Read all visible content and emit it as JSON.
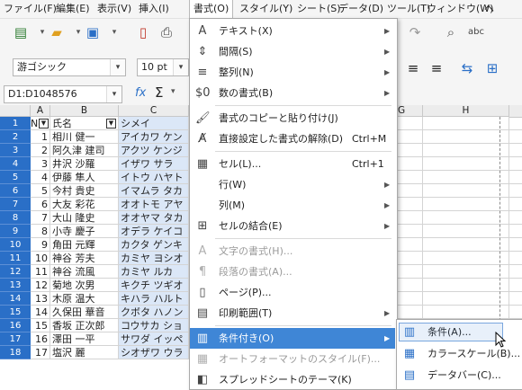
{
  "menubar": {
    "items": [
      {
        "label": "ファイル(F)"
      },
      {
        "label": "編集(E)"
      },
      {
        "label": "表示(V)"
      },
      {
        "label": "挿入(I)"
      },
      {
        "label": "書式(O)"
      },
      {
        "label": "スタイル(Y)"
      },
      {
        "label": "シート(S)"
      },
      {
        "label": "データ(D)"
      },
      {
        "label": "ツール(T)"
      },
      {
        "label": "ウィンドウ(W)"
      },
      {
        "label": "ヘ"
      }
    ],
    "active_index": 4
  },
  "toolbar": {
    "font_name": "游ゴシック",
    "font_size": "10 pt",
    "icons": [
      "new-icon",
      "open-icon",
      "save-icon",
      "export-pdf-icon",
      "print-icon"
    ]
  },
  "formula_bar": {
    "name_box": "D1:D1048576",
    "fx": "fx",
    "sum": "Σ"
  },
  "sheet": {
    "columns": [
      "A",
      "B",
      "C",
      "G",
      "H"
    ],
    "header_row": {
      "a": "No",
      "b": "氏名",
      "c": "シメイ"
    },
    "rows": [
      {
        "row": "2",
        "no": "1",
        "name": "相川 健一",
        "kana": "アイカワ ケン"
      },
      {
        "row": "3",
        "no": "2",
        "name": "阿久津 建司",
        "kana": "アクツ ケンジ"
      },
      {
        "row": "4",
        "no": "3",
        "name": "井沢 沙羅",
        "kana": "イザワ サラ"
      },
      {
        "row": "5",
        "no": "4",
        "name": "伊藤 隼人",
        "kana": "イトウ ハヤト"
      },
      {
        "row": "6",
        "no": "5",
        "name": "今村 貴史",
        "kana": "イマムラ タカ"
      },
      {
        "row": "7",
        "no": "6",
        "name": "大友 彩花",
        "kana": "オオトモ アヤ"
      },
      {
        "row": "8",
        "no": "7",
        "name": "大山 隆史",
        "kana": "オオヤマ タカ"
      },
      {
        "row": "9",
        "no": "8",
        "name": "小寺 慶子",
        "kana": "オデラ ケイコ"
      },
      {
        "row": "10",
        "no": "9",
        "name": "角田 元輝",
        "kana": "カクタ ゲンキ"
      },
      {
        "row": "11",
        "no": "10",
        "name": "神谷 芳夫",
        "kana": "カミヤ ヨシオ"
      },
      {
        "row": "12",
        "no": "11",
        "name": "神谷 流風",
        "kana": "カミヤ ルカ"
      },
      {
        "row": "13",
        "no": "12",
        "name": "菊地 次男",
        "kana": "キクチ ツギオ"
      },
      {
        "row": "14",
        "no": "13",
        "name": "木原 温大",
        "kana": "キハラ ハルト"
      },
      {
        "row": "15",
        "no": "14",
        "name": "久保田 華音",
        "kana": "クボタ ハノン"
      },
      {
        "row": "16",
        "no": "15",
        "name": "香坂 正次郎",
        "kana": "コウサカ ショ"
      },
      {
        "row": "17",
        "no": "16",
        "name": "澤田 一平",
        "kana": "サワダ イッペ"
      },
      {
        "row": "18",
        "no": "17",
        "name": "塩沢 麗",
        "kana": "シオザワ ウラ"
      }
    ]
  },
  "format_menu": {
    "items": [
      {
        "icon": "text-icon",
        "glyph": "A",
        "label": "テキスト(X)",
        "shortcut": "",
        "submenu": true,
        "disabled": false
      },
      {
        "icon": "spacing-icon",
        "glyph": "⇕",
        "label": "間隔(S)",
        "shortcut": "",
        "submenu": true,
        "disabled": false
      },
      {
        "icon": "align-icon",
        "glyph": "≡",
        "label": "整列(N)",
        "shortcut": "",
        "submenu": true,
        "disabled": false
      },
      {
        "icon": "number-format-icon",
        "glyph": "$0",
        "label": "数の書式(B)",
        "shortcut": "",
        "submenu": true,
        "disabled": false
      },
      {
        "sep": true
      },
      {
        "icon": "clone-format-icon",
        "glyph": "🖌",
        "label": "書式のコピーと貼り付け(J)",
        "shortcut": "",
        "submenu": false,
        "disabled": false
      },
      {
        "icon": "clear-format-icon",
        "glyph": "A̸",
        "label": "直接設定した書式の解除(D)",
        "shortcut": "Ctrl+M",
        "submenu": false,
        "disabled": false
      },
      {
        "sep": true
      },
      {
        "icon": "cells-icon",
        "glyph": "▦",
        "label": "セル(L)...",
        "shortcut": "Ctrl+1",
        "submenu": false,
        "disabled": false
      },
      {
        "icon": "",
        "glyph": "",
        "label": "行(W)",
        "shortcut": "",
        "submenu": true,
        "disabled": false
      },
      {
        "icon": "",
        "glyph": "",
        "label": "列(M)",
        "shortcut": "",
        "submenu": true,
        "disabled": false
      },
      {
        "icon": "merge-cells-icon",
        "glyph": "⊞",
        "label": "セルの結合(E)",
        "shortcut": "",
        "submenu": true,
        "disabled": false
      },
      {
        "sep": true
      },
      {
        "icon": "character-icon",
        "glyph": "A",
        "label": "文字の書式(H)...",
        "shortcut": "",
        "submenu": false,
        "disabled": true
      },
      {
        "icon": "paragraph-icon",
        "glyph": "¶",
        "label": "段落の書式(A)...",
        "shortcut": "",
        "submenu": false,
        "disabled": true
      },
      {
        "icon": "page-icon",
        "glyph": "▯",
        "label": "ページ(P)...",
        "shortcut": "",
        "submenu": false,
        "disabled": false
      },
      {
        "icon": "print-range-icon",
        "glyph": "▤",
        "label": "印刷範囲(T)",
        "shortcut": "",
        "submenu": true,
        "disabled": false
      },
      {
        "sep": true
      },
      {
        "icon": "conditional-icon",
        "glyph": "▥",
        "label": "条件付き(O)",
        "shortcut": "",
        "submenu": true,
        "disabled": false,
        "highlight": true
      },
      {
        "icon": "autoformat-icon",
        "glyph": "▦",
        "label": "オートフォーマットのスタイル(F)...",
        "shortcut": "",
        "submenu": false,
        "disabled": true
      },
      {
        "icon": "theme-icon",
        "glyph": "◧",
        "label": "スプレッドシートのテーマ(K)",
        "shortcut": "",
        "submenu": false,
        "disabled": false
      }
    ]
  },
  "conditional_submenu": {
    "items": [
      {
        "icon": "condition-icon",
        "glyph": "▥",
        "label": "条件(A)..."
      },
      {
        "icon": "color-scale-icon",
        "glyph": "▦",
        "label": "カラースケール(B)..."
      },
      {
        "icon": "data-bar-icon",
        "glyph": "▤",
        "label": "データバー(C)..."
      }
    ]
  },
  "colors": {
    "accent": "#3f86d6",
    "row_header": "#2a6fc7",
    "selection": "#dbe7f7"
  }
}
